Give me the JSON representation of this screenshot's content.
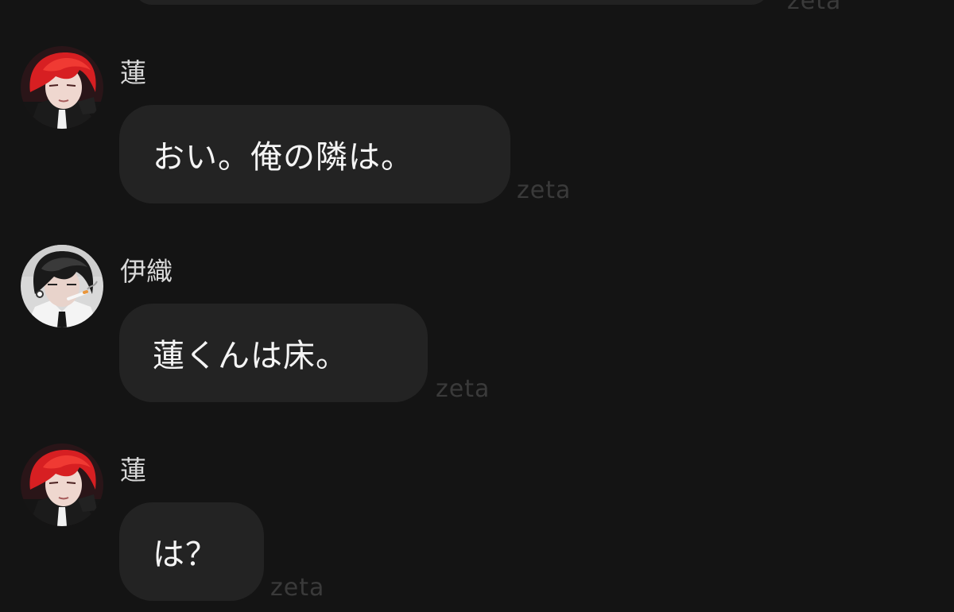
{
  "watermark": "zeta",
  "messages": [
    {
      "sender": "蓮",
      "avatar": "red-haired-character-avatar",
      "text": "おい。俺の隣は。"
    },
    {
      "sender": "伊織",
      "avatar": "black-haired-character-avatar",
      "text": "蓮くんは床。"
    },
    {
      "sender": "蓮",
      "avatar": "red-haired-character-avatar",
      "text": "は？"
    }
  ],
  "colors": {
    "background": "#141414",
    "bubble": "#232323",
    "text": "#f4f4f4",
    "sender_name": "#d8d8d8",
    "watermark": "#3a3a3a"
  }
}
